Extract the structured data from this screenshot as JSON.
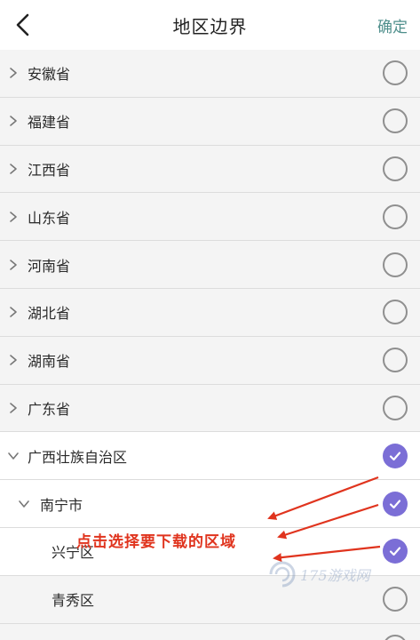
{
  "header": {
    "title": "地区边界",
    "confirm_label": "确定"
  },
  "regions": [
    {
      "label": "安徽省",
      "level": 0,
      "expanded": false,
      "checked": false
    },
    {
      "label": "福建省",
      "level": 0,
      "expanded": false,
      "checked": false
    },
    {
      "label": "江西省",
      "level": 0,
      "expanded": false,
      "checked": false
    },
    {
      "label": "山东省",
      "level": 0,
      "expanded": false,
      "checked": false
    },
    {
      "label": "河南省",
      "level": 0,
      "expanded": false,
      "checked": false
    },
    {
      "label": "湖北省",
      "level": 0,
      "expanded": false,
      "checked": false
    },
    {
      "label": "湖南省",
      "level": 0,
      "expanded": false,
      "checked": false
    },
    {
      "label": "广东省",
      "level": 0,
      "expanded": false,
      "checked": false
    },
    {
      "label": "广西壮族自治区",
      "level": 0,
      "expanded": true,
      "checked": true
    },
    {
      "label": "南宁市",
      "level": 1,
      "expanded": true,
      "checked": true
    },
    {
      "label": "兴宁区",
      "level": 2,
      "checked": true
    },
    {
      "label": "青秀区",
      "level": 2,
      "checked": false
    },
    {
      "label": "",
      "level": 2,
      "checked": false
    }
  ],
  "annotation": {
    "text": "点击选择要下载的区域"
  },
  "watermark": {
    "text": "175游戏网"
  },
  "colors": {
    "check_fill": "#7b6ed6",
    "annotation_red": "#e0341e",
    "confirm_teal": "#4f8f8c"
  }
}
